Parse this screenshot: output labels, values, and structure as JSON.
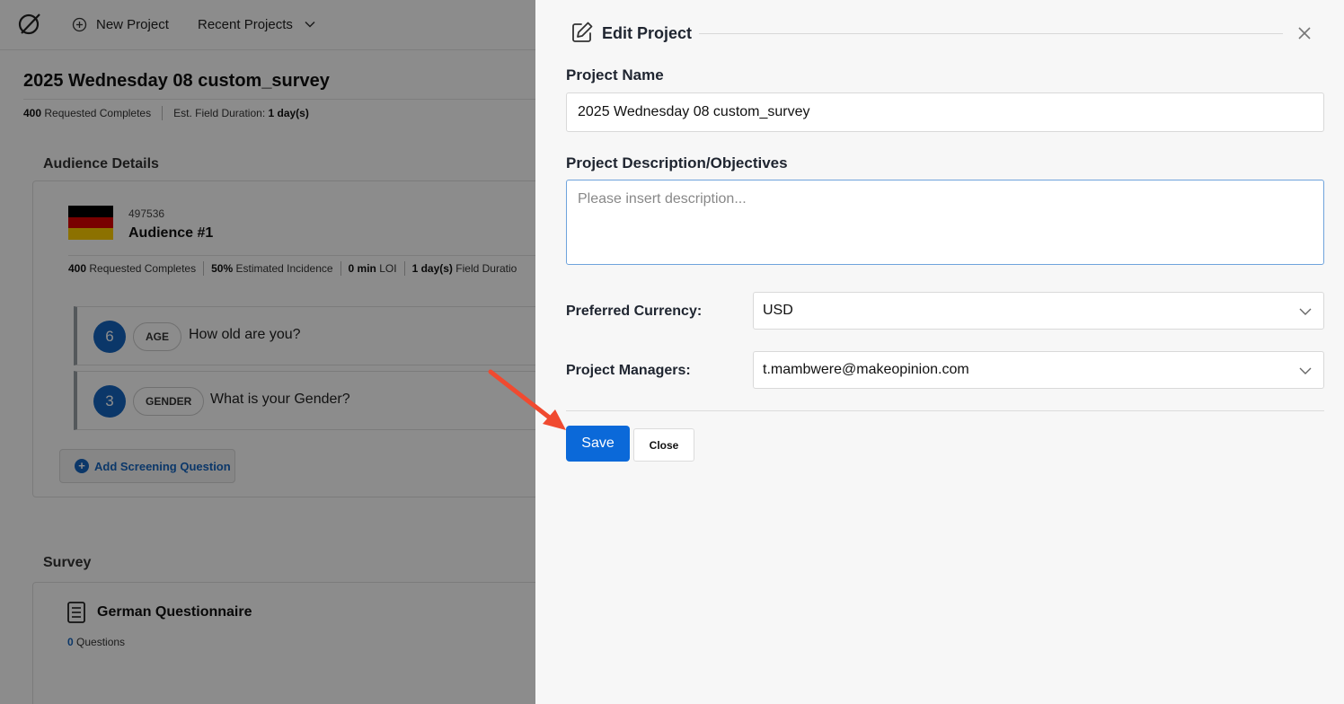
{
  "topbar": {
    "logo_icon": "circle-slash-logo",
    "new_project_label": "New Project",
    "recent_projects_label": "Recent Projects"
  },
  "project": {
    "title": "2025 Wednesday 08 custom_survey",
    "requested_completes_value": "400",
    "requested_completes_label": "Requested Completes",
    "field_duration_label": "Est. Field Duration:",
    "field_duration_value": "1 day(s)"
  },
  "audience_section": {
    "heading": "Audience Details",
    "audience_id": "497536",
    "audience_name": "Audience #1",
    "flag_colors": [
      "#000000",
      "#dd0000",
      "#ffce00"
    ],
    "meta": {
      "completes_value": "400",
      "completes_label": "Requested Completes",
      "incidence_value": "50%",
      "incidence_label": "Estimated Incidence",
      "loi_value": "0 min",
      "loi_label": "LOI",
      "duration_value": "1 day(s)",
      "duration_label": "Field Duratio"
    },
    "questions": [
      {
        "count": "6",
        "tag": "AGE",
        "text": "How old are you?"
      },
      {
        "count": "3",
        "tag": "GENDER",
        "text": "What is your Gender?"
      }
    ],
    "add_question_label": "Add Screening Question"
  },
  "survey_section": {
    "heading": "Survey",
    "questionnaire_title": "German Questionnaire",
    "question_count": "0",
    "question_count_label": "Questions"
  },
  "edit_panel": {
    "title": "Edit Project",
    "project_name_label": "Project Name",
    "project_name_value": "2025 Wednesday 08 custom_survey",
    "description_label": "Project Description/Objectives",
    "description_placeholder": "Please insert description...",
    "currency_label": "Preferred Currency:",
    "currency_value": "USD",
    "managers_label": "Project Managers:",
    "managers_value": "t.mambwere@makeopinion.com",
    "save_label": "Save",
    "close_label": "Close"
  },
  "colors": {
    "primary": "#0b69d9",
    "question_badge": "#1565c0",
    "annotation_arrow": "#f04a30"
  }
}
